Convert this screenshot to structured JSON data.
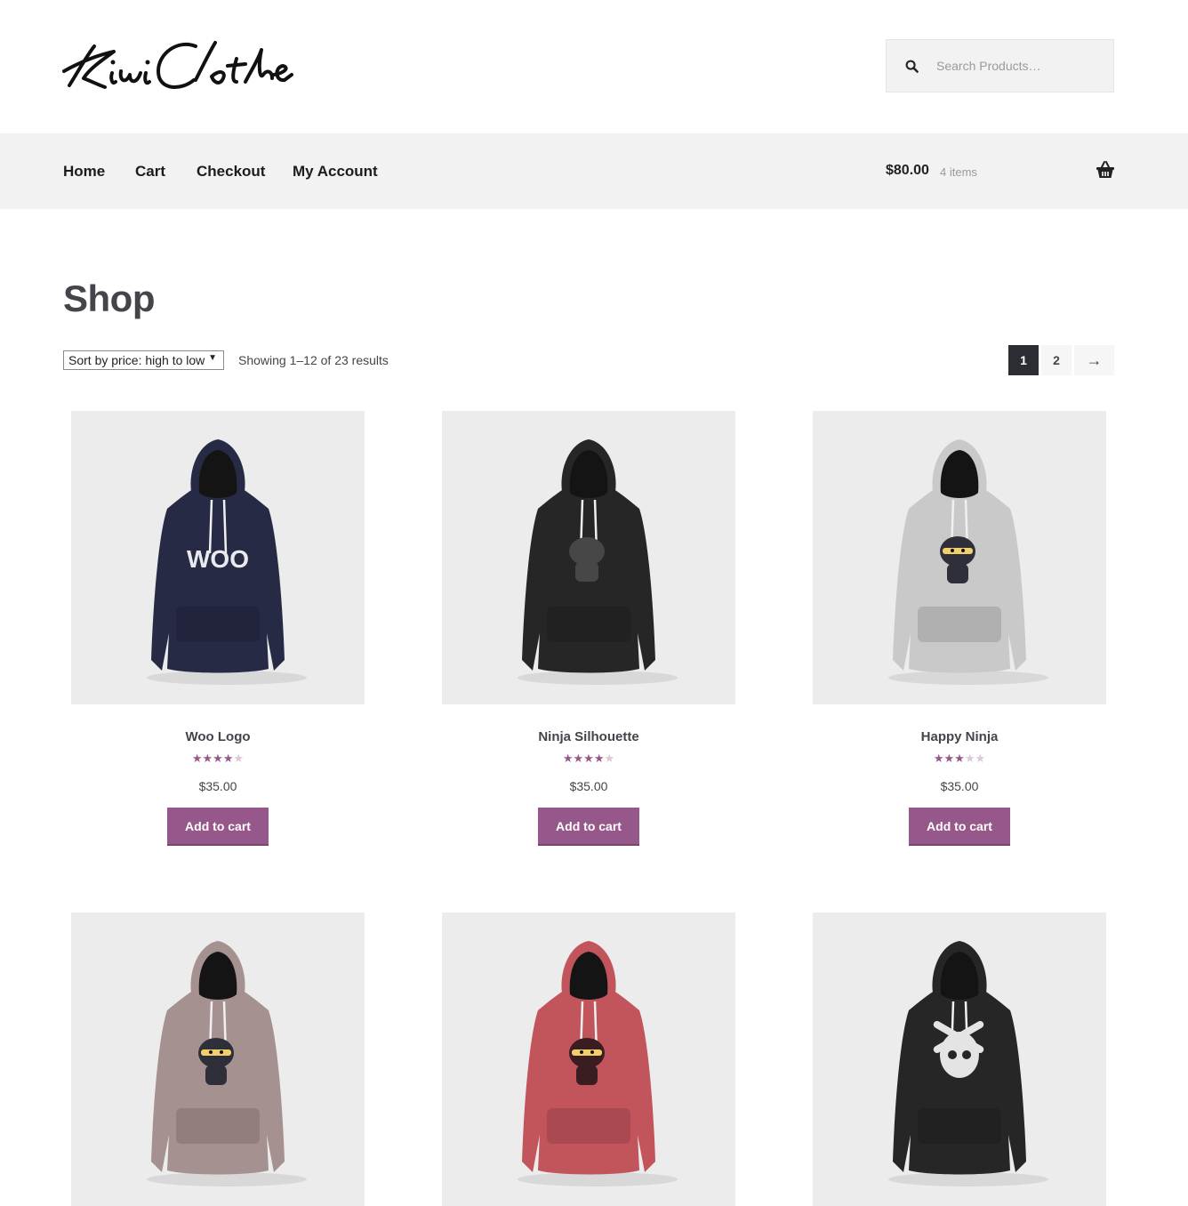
{
  "header": {
    "logo_text": "Kiwi Clothes",
    "search": {
      "placeholder": "Search Products…"
    }
  },
  "nav": {
    "items": [
      {
        "label": "Home"
      },
      {
        "label": "Cart"
      },
      {
        "label": "Checkout"
      },
      {
        "label": "My Account"
      }
    ],
    "cart_total": "$80.00",
    "cart_count": "4 items"
  },
  "shop": {
    "title": "Shop",
    "sort_selected": "Sort by price: high to low",
    "result_count": "Showing 1–12 of 23 results",
    "pagination": {
      "current": "1",
      "next_page": "2",
      "next_arrow": "→"
    }
  },
  "products": [
    {
      "name": "Woo Logo",
      "rating": 4,
      "price": "$35.00",
      "button": "Add to cart",
      "hoodie_color": "#262a45",
      "graphic": "woo"
    },
    {
      "name": "Ninja Silhouette",
      "rating": 4,
      "price": "$35.00",
      "button": "Add to cart",
      "hoodie_color": "#262626",
      "graphic": "ninja-silhouette"
    },
    {
      "name": "Happy Ninja",
      "rating": 3,
      "price": "$35.00",
      "button": "Add to cart",
      "hoodie_color": "#c9c9c9",
      "graphic": "ninja"
    },
    {
      "name": "",
      "rating": 0,
      "price": "",
      "button": "",
      "hoodie_color": "#a5918f",
      "graphic": "ninja"
    },
    {
      "name": "",
      "rating": 0,
      "price": "",
      "button": "",
      "hoodie_color": "#c2545c",
      "graphic": "ninja-dark"
    },
    {
      "name": "",
      "rating": 0,
      "price": "",
      "button": "",
      "hoodie_color": "#262626",
      "graphic": "skull"
    }
  ],
  "colors": {
    "accent": "#96588a",
    "nav_bg": "#f2f2f2",
    "pager_active": "#2c2d33"
  },
  "icons": {
    "search": "search-icon",
    "cart": "basket-icon"
  }
}
